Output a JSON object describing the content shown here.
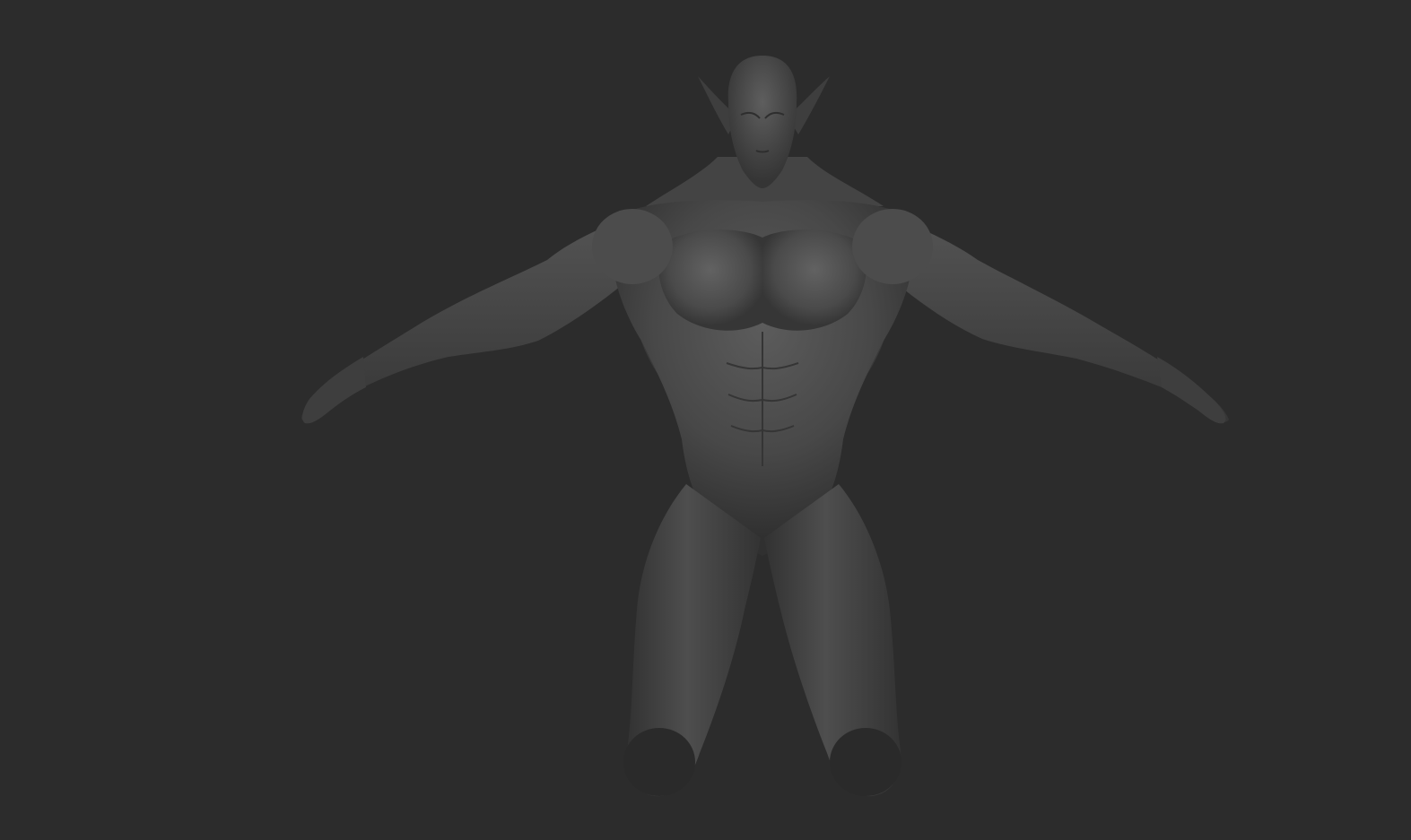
{
  "viewport": {
    "background_color": "#2c2c2c",
    "material_color": "#4a4a4a",
    "highlight_color": "#6a6a6a",
    "shadow_color": "#1c1c1c"
  },
  "model": {
    "icon": "sculpt-mesh-icon"
  }
}
